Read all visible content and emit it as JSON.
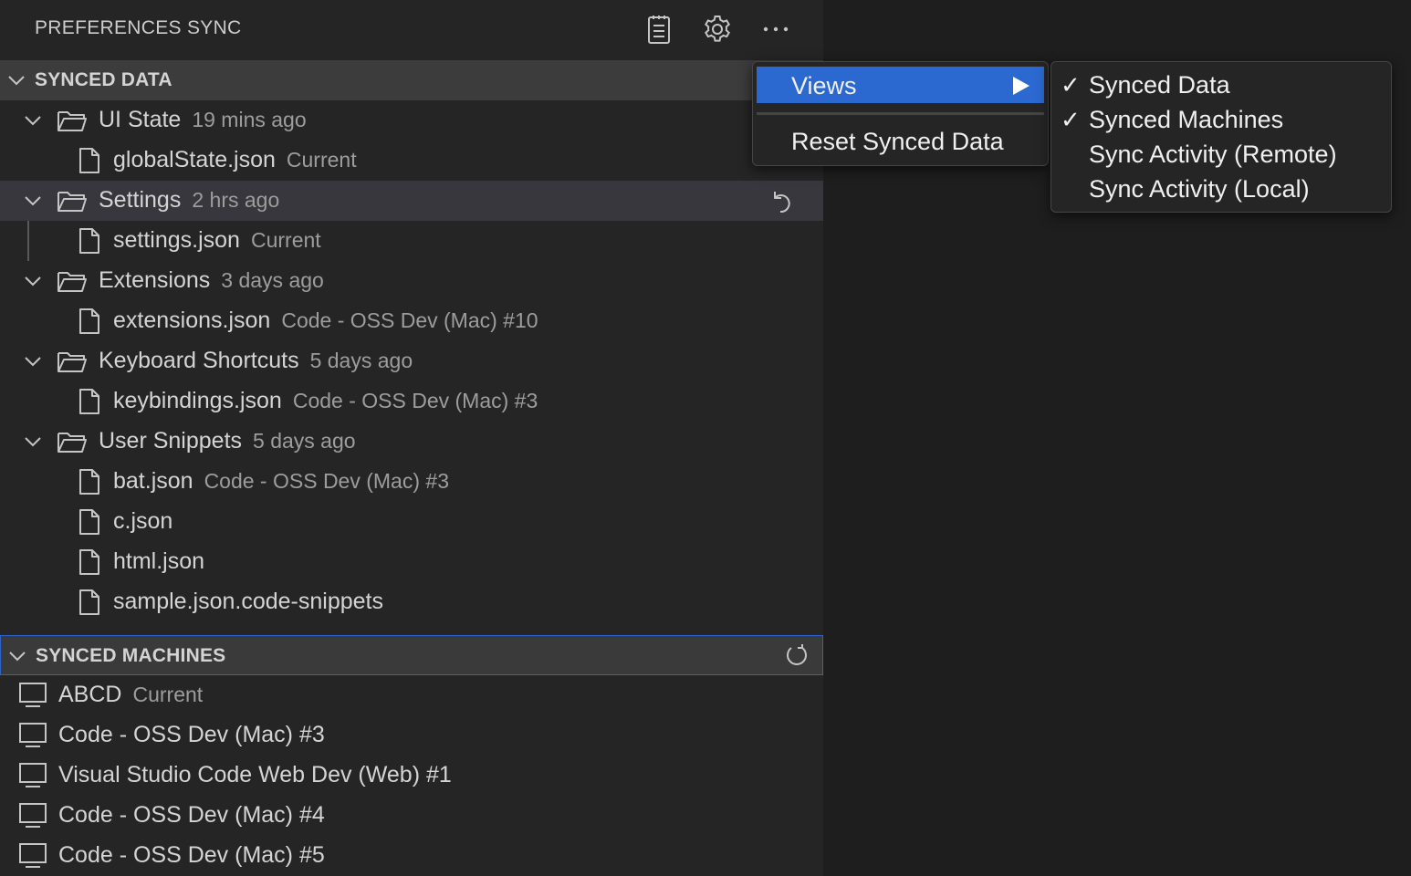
{
  "title": "PREFERENCES SYNC",
  "title_actions": [
    {
      "icon": "list-icon"
    },
    {
      "icon": "gear-icon"
    },
    {
      "icon": "more-icon"
    }
  ],
  "synced_data": {
    "title": "SYNCED DATA",
    "groups": [
      {
        "label": "UI State",
        "desc": "19 mins ago",
        "files": [
          {
            "label": "globalState.json",
            "desc": "Current"
          }
        ]
      },
      {
        "label": "Settings",
        "desc": "2 hrs ago",
        "action_icon": "undo-icon",
        "files": [
          {
            "label": "settings.json",
            "desc": "Current"
          }
        ]
      },
      {
        "label": "Extensions",
        "desc": "3 days ago",
        "files": [
          {
            "label": "extensions.json",
            "desc": "Code - OSS Dev (Mac) #10"
          }
        ]
      },
      {
        "label": "Keyboard Shortcuts",
        "desc": "5 days ago",
        "files": [
          {
            "label": "keybindings.json",
            "desc": "Code - OSS Dev (Mac) #3"
          }
        ]
      },
      {
        "label": "User Snippets",
        "desc": "5 days ago",
        "files": [
          {
            "label": "bat.json",
            "desc": "Code - OSS Dev (Mac) #3"
          },
          {
            "label": "c.json",
            "desc": ""
          },
          {
            "label": "html.json",
            "desc": ""
          },
          {
            "label": "sample.json.code-snippets",
            "desc": ""
          }
        ]
      }
    ]
  },
  "synced_machines": {
    "title": "SYNCED MACHINES",
    "action_icon": "refresh-icon",
    "items": [
      {
        "label": "ABCD",
        "desc": "Current"
      },
      {
        "label": "Code - OSS Dev (Mac) #3",
        "desc": ""
      },
      {
        "label": "Visual Studio Code Web Dev (Web) #1",
        "desc": ""
      },
      {
        "label": "Code - OSS Dev (Mac) #4",
        "desc": ""
      },
      {
        "label": "Code - OSS Dev (Mac) #5",
        "desc": ""
      }
    ]
  },
  "context_menu": {
    "items": [
      {
        "label": "Views",
        "has_submenu": true,
        "highlighted": true
      },
      {
        "label": "Reset Synced Data",
        "has_submenu": false,
        "highlighted": false
      }
    ],
    "submenu": {
      "items": [
        {
          "label": "Synced Data",
          "checked": true
        },
        {
          "label": "Synced Machines",
          "checked": true
        },
        {
          "label": "Sync Activity (Remote)",
          "checked": false
        },
        {
          "label": "Sync Activity (Local)",
          "checked": false
        }
      ]
    }
  },
  "colors": {
    "sidebar_bg": "#252526",
    "section_header_bg": "#3c3c3c",
    "selection_bg": "#37373d",
    "focus_border": "#2c64c8",
    "menu_highlight": "#2b68d0"
  }
}
